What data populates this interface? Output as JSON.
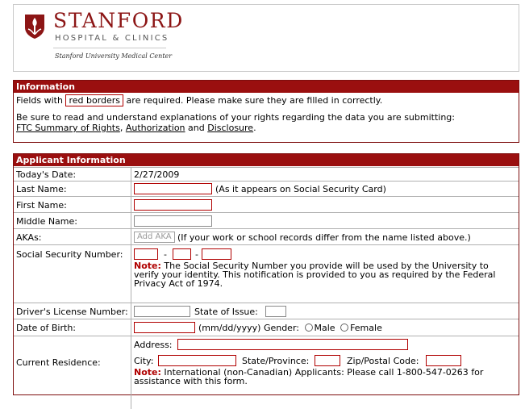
{
  "brand": {
    "title": "STANFORD",
    "subtitle": "HOSPITAL & CLINICS",
    "center": "Stanford University Medical Center"
  },
  "info": {
    "header": "Information",
    "req_prefix": "Fields with",
    "req_sample": "red borders",
    "req_suffix": "are required. Please make sure they are filled in correctly.",
    "rights_text": "Be sure to read and understand explanations of your rights regarding the data you are submitting:",
    "link_ftc": "FTC Summary of Rights",
    "sep": ",",
    "link_auth": "Authorization",
    "and": "and",
    "link_disc": "Disclosure",
    "period": "."
  },
  "applicant": {
    "header": "Applicant Information",
    "date_label": "Today's Date:",
    "date_value": "2/27/2009",
    "last_label": "Last Name:",
    "last_hint": "(As it appears on Social Security Card)",
    "first_label": "First Name:",
    "middle_label": "Middle Name:",
    "aka_label": "AKAs:",
    "aka_button": "Add AKA",
    "aka_hint": "(If your work or school records differ from the name listed above.)",
    "ssn_label": "Social Security Number:",
    "ssn_dash": "-",
    "ssn_note_label": "Note:",
    "ssn_note_line1": "The Social Security Number you provide will be used by the University to",
    "ssn_note_line2": "verify your identity. This notification is provided to you as required by the Federal",
    "ssn_note_line3": "Privacy Act of 1974.",
    "dl_label": "Driver's License Number:",
    "dl_state_label": "State of Issue:",
    "dob_label": "Date of Birth:",
    "dob_hint": "(mm/dd/yyyy)",
    "gender_label": "Gender:",
    "gender_male": "Male",
    "gender_female": "Female",
    "res_label": "Current Residence:",
    "addr_label": "Address:",
    "city_label": "City:",
    "state_label": "State/Province:",
    "zip_label": "Zip/Postal Code:",
    "res_note_label": "Note:",
    "res_note_line1": "International (non-Canadian) Applicants: Please call 1-800-547-0263 for",
    "res_note_line2": "assistance with this form."
  },
  "colors": {
    "brand_red": "#8c1515",
    "header_red": "#9a0f0f",
    "required_border": "#b00000"
  }
}
